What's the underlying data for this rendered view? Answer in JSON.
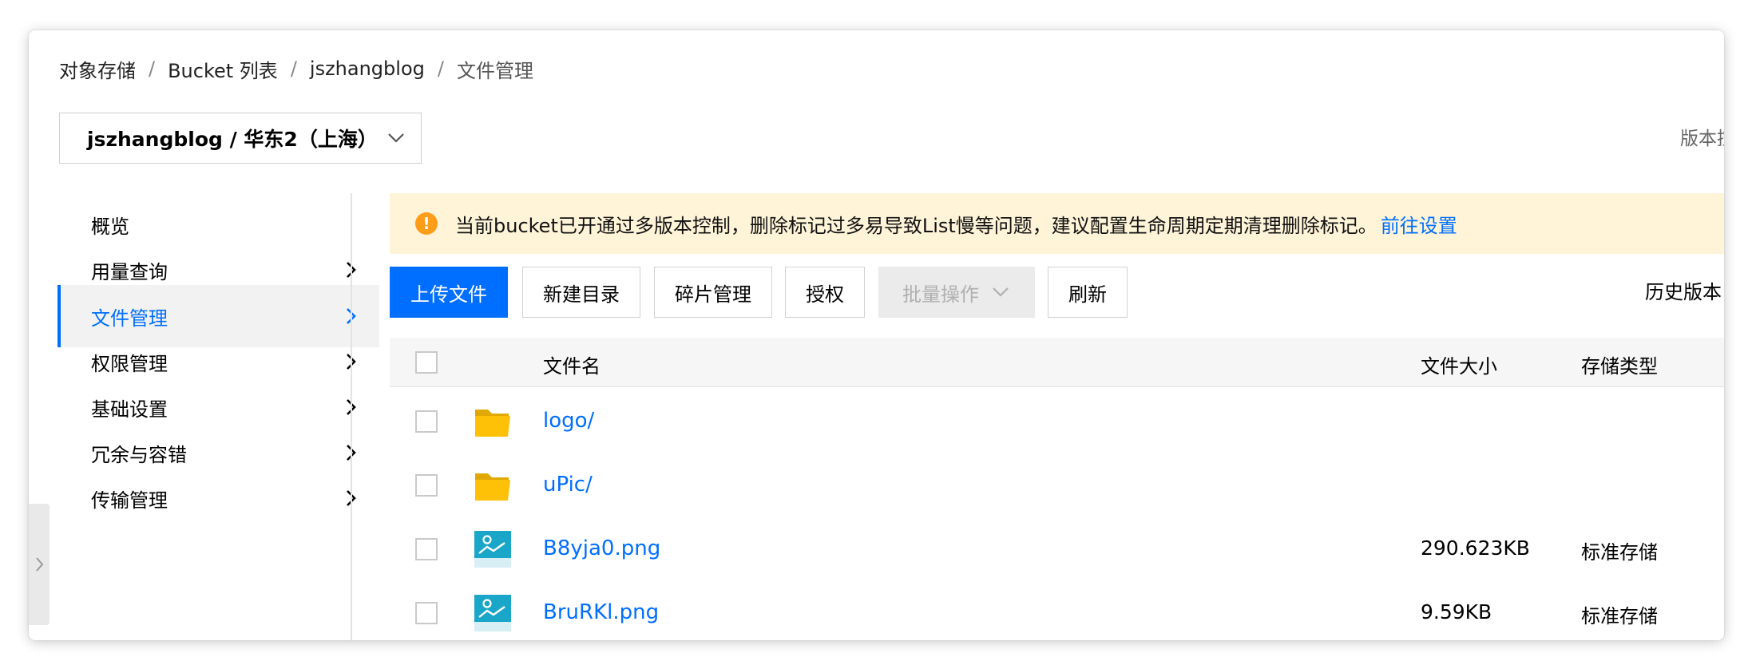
{
  "breadcrumb": [
    "对象存储",
    "Bucket 列表",
    "jszhangblog",
    "文件管理"
  ],
  "breadcrumb_sep": "/",
  "bucket_select": {
    "value": "jszhangblog / 华东2（上海）"
  },
  "version_text": "版本控",
  "sidebar": {
    "items": [
      {
        "label": "概览",
        "has_arrow": false,
        "active": false
      },
      {
        "label": "用量查询",
        "has_arrow": true,
        "active": false
      },
      {
        "label": "文件管理",
        "has_arrow": true,
        "active": true
      },
      {
        "label": "权限管理",
        "has_arrow": true,
        "active": false
      },
      {
        "label": "基础设置",
        "has_arrow": true,
        "active": false
      },
      {
        "label": "冗余与容错",
        "has_arrow": true,
        "active": false
      },
      {
        "label": "传输管理",
        "has_arrow": true,
        "active": false
      }
    ]
  },
  "notice": {
    "text": "当前bucket已开通过多版本控制，删除标记过多易导致List慢等问题，建议配置生命周期定期清理删除标记。",
    "link": "前往设置",
    "icon": "exclamation-circle-icon"
  },
  "toolbar": {
    "upload": "上传文件",
    "new_folder": "新建目录",
    "fragments": "碎片管理",
    "authorize": "授权",
    "batch": "批量操作",
    "refresh": "刷新",
    "history": "历史版本"
  },
  "table": {
    "headers": {
      "name": "文件名",
      "size": "文件大小",
      "type": "存储类型"
    },
    "rows": [
      {
        "name": "logo/",
        "icon": "folder-icon",
        "size": "",
        "type": ""
      },
      {
        "name": "uPic/",
        "icon": "folder-icon",
        "size": "",
        "type": ""
      },
      {
        "name": "B8yja0.png",
        "icon": "image-file-icon",
        "size": "290.623KB",
        "type": "标准存储"
      },
      {
        "name": "BruRKl.png",
        "icon": "image-file-icon",
        "size": "9.59KB",
        "type": "标准存储"
      }
    ]
  },
  "colors": {
    "accent": "#006eff",
    "notice_bg": "#fff4d8",
    "warn": "#ff9c19",
    "folder": "#ffc107",
    "image_icon": "#1aa6c9"
  }
}
